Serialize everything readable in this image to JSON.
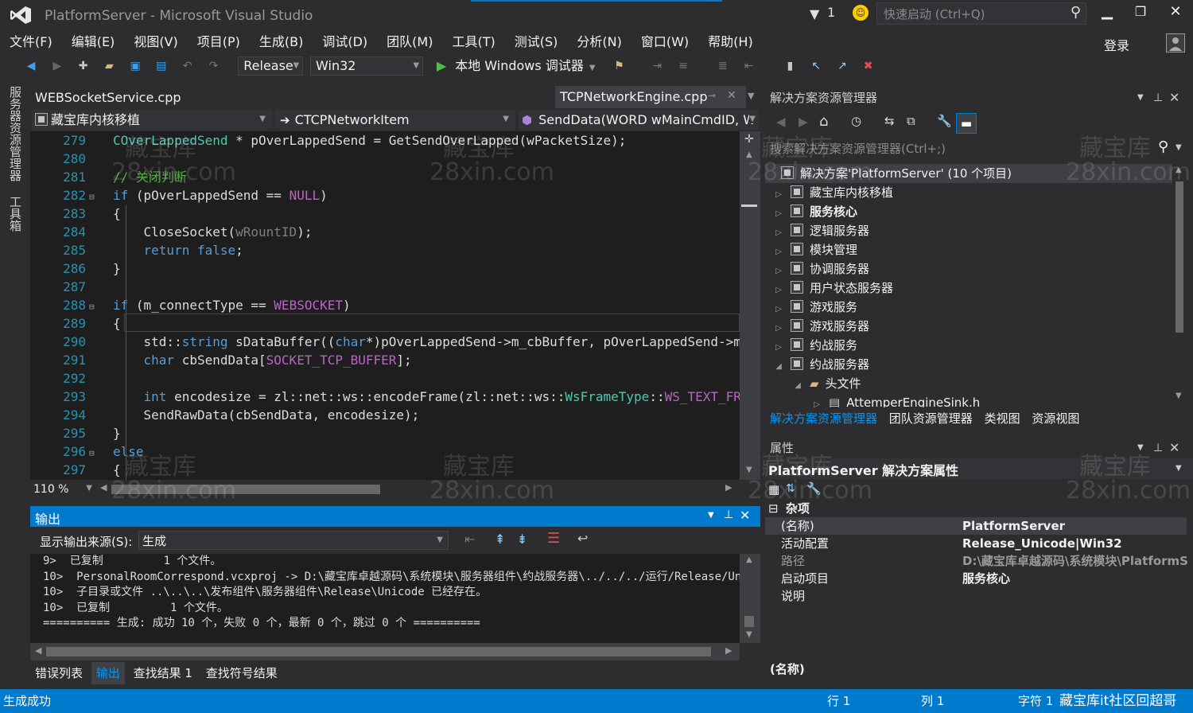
{
  "window": {
    "title": "PlatformServer - Microsoft Visual Studio",
    "notifications": "1",
    "quicklaunch_placeholder": "快速启动 (Ctrl+Q)",
    "signin": "登录"
  },
  "menu": [
    "文件(F)",
    "编辑(E)",
    "视图(V)",
    "项目(P)",
    "生成(B)",
    "调试(D)",
    "团队(M)",
    "工具(T)",
    "测试(S)",
    "分析(N)",
    "窗口(W)",
    "帮助(H)"
  ],
  "toolbar": {
    "config": "Release",
    "platform": "Win32",
    "debugger": "本地 Windows 调试器"
  },
  "leftstrip": [
    "服务器资源管理器",
    "工具箱"
  ],
  "editor": {
    "tabs": [
      "WEBSocketService.cpp",
      "TCPNetworkEngine.cpp"
    ],
    "nav": [
      "藏宝库内核移植",
      "CTCPNetworkItem",
      "SendData(WORD wMainCmdID, W"
    ],
    "zoom": "110 %",
    "lines": [
      {
        "n": "279",
        "t": [
          [
            "ty",
            "COverLappedSend"
          ],
          [
            "nm",
            " * pOverLappedSend = GetSendOverLapped(wPacketSize);"
          ]
        ]
      },
      {
        "n": "280",
        "t": []
      },
      {
        "n": "281",
        "t": [
          [
            "cm",
            "// 关闭判断"
          ]
        ]
      },
      {
        "n": "282",
        "f": "⊟",
        "t": [
          [
            "kw",
            "if"
          ],
          [
            "nm",
            " (pOverLappedSend == "
          ],
          [
            "mc",
            "NULL"
          ],
          [
            "nm",
            ")"
          ]
        ]
      },
      {
        "n": "283",
        "t": [
          [
            "nm",
            "{"
          ]
        ]
      },
      {
        "n": "284",
        "t": [
          [
            "nm",
            "    CloseSocket("
          ],
          [
            "vr",
            "wRountID"
          ],
          [
            "nm",
            ");"
          ]
        ]
      },
      {
        "n": "285",
        "t": [
          [
            "kw",
            "    return"
          ],
          [
            "nm",
            " "
          ],
          [
            "kw",
            "false"
          ],
          [
            "nm",
            ";"
          ]
        ]
      },
      {
        "n": "286",
        "t": [
          [
            "nm",
            "}"
          ]
        ]
      },
      {
        "n": "287",
        "t": []
      },
      {
        "n": "288",
        "f": "⊟",
        "t": [
          [
            "kw",
            "if"
          ],
          [
            "nm",
            " (m_connectType == "
          ],
          [
            "mc",
            "WEBSOCKET"
          ],
          [
            "nm",
            ")"
          ]
        ]
      },
      {
        "n": "289",
        "t": [
          [
            "nm",
            "{"
          ]
        ]
      },
      {
        "n": "290",
        "t": [
          [
            "nm",
            "    std::"
          ],
          [
            "kw",
            "string"
          ],
          [
            "nm",
            " sDataBuffer(("
          ],
          [
            "kw",
            "char"
          ],
          [
            "nm",
            "*)pOverLappedSend->m_cbBuffer, pOverLappedSend->m"
          ]
        ]
      },
      {
        "n": "291",
        "t": [
          [
            "kw",
            "    char"
          ],
          [
            "nm",
            " cbSendData["
          ],
          [
            "mc",
            "SOCKET_TCP_BUFFER"
          ],
          [
            "nm",
            "];"
          ]
        ]
      },
      {
        "n": "292",
        "t": []
      },
      {
        "n": "293",
        "t": [
          [
            "kw",
            "    int"
          ],
          [
            "nm",
            " encodesize = zl::net::ws::encodeFrame(zl::net::ws::"
          ],
          [
            "ty",
            "WsFrameType"
          ],
          [
            "nm",
            "::"
          ],
          [
            "mc",
            "WS_TEXT_FR"
          ]
        ]
      },
      {
        "n": "294",
        "t": [
          [
            "nm",
            "    SendRawData(cbSendData, encodesize);"
          ]
        ]
      },
      {
        "n": "295",
        "t": [
          [
            "nm",
            "}"
          ]
        ]
      },
      {
        "n": "296",
        "f": "⊟",
        "t": [
          [
            "kw",
            "else"
          ]
        ]
      },
      {
        "n": "297",
        "t": [
          [
            "nm",
            "{"
          ]
        ]
      }
    ]
  },
  "output": {
    "title": "输出",
    "source_label": "显示输出来源(S):",
    "source": "生成",
    "lines": [
      "9>  已复制         1 个文件。",
      "10>  PersonalRoomCorrespond.vcxproj -> D:\\藏宝库卓越源码\\系统模块\\服务器组件\\约战服务器\\../../../运行/Release/Un",
      "10>  子目录或文件 ..\\..\\..\\发布组件\\服务器组件\\Release\\Unicode 已经存在。",
      "10>  已复制         1 个文件。",
      "========== 生成: 成功 10 个，失败 0 个，最新 0 个，跳过 0 个 =========="
    ]
  },
  "bottom_tabs": [
    "错误列表",
    "输出",
    "查找结果 1",
    "查找符号结果"
  ],
  "status": {
    "left": "生成成功",
    "line": "行 1",
    "col": "列 1",
    "char": "字符 1",
    "brand": "藏宝库it社区回超哥"
  },
  "solution": {
    "title": "解决方案资源管理器",
    "search_placeholder": "搜索解决方案资源管理器(Ctrl+;)",
    "root": "解决方案'PlatformServer' (10 个项目)",
    "items": [
      {
        "label": "藏宝库内核移植",
        "tri": "▷",
        "bold": false
      },
      {
        "label": "服务核心",
        "tri": "▷",
        "bold": true
      },
      {
        "label": "逻辑服务器",
        "tri": "▷",
        "bold": false
      },
      {
        "label": "模块管理",
        "tri": "▷",
        "bold": false
      },
      {
        "label": "协调服务器",
        "tri": "▷",
        "bold": false
      },
      {
        "label": "用户状态服务器",
        "tri": "▷",
        "bold": false
      },
      {
        "label": "游戏服务",
        "tri": "▷",
        "bold": false
      },
      {
        "label": "游戏服务器",
        "tri": "▷",
        "bold": false
      },
      {
        "label": "约战服务",
        "tri": "▷",
        "bold": false
      },
      {
        "label": "约战服务器",
        "tri": "◢",
        "bold": false
      }
    ],
    "folder": "头文件",
    "file": "AttemperEngineSink.h",
    "tabs": [
      "解决方案资源管理器",
      "团队资源管理器",
      "类视图",
      "资源视图"
    ]
  },
  "properties": {
    "title": "属性",
    "object": "PlatformServer 解决方案属性",
    "category": "杂项",
    "rows": [
      {
        "k": "(名称)",
        "v": "PlatformServer"
      },
      {
        "k": "活动配置",
        "v": "Release_Unicode|Win32"
      },
      {
        "k": "路径",
        "v": "D:\\藏宝库卓越源码\\系统模块\\PlatformS"
      },
      {
        "k": "启动项目",
        "v": "服务核心"
      },
      {
        "k": "说明",
        "v": ""
      }
    ],
    "desc_title": "(名称)"
  },
  "watermark": {
    "cn": "藏宝库",
    "en": "28xin.com"
  },
  "colors": {
    "accent": "#007acc",
    "bg": "#2d2d30",
    "editor_bg": "#1e1e1e"
  }
}
